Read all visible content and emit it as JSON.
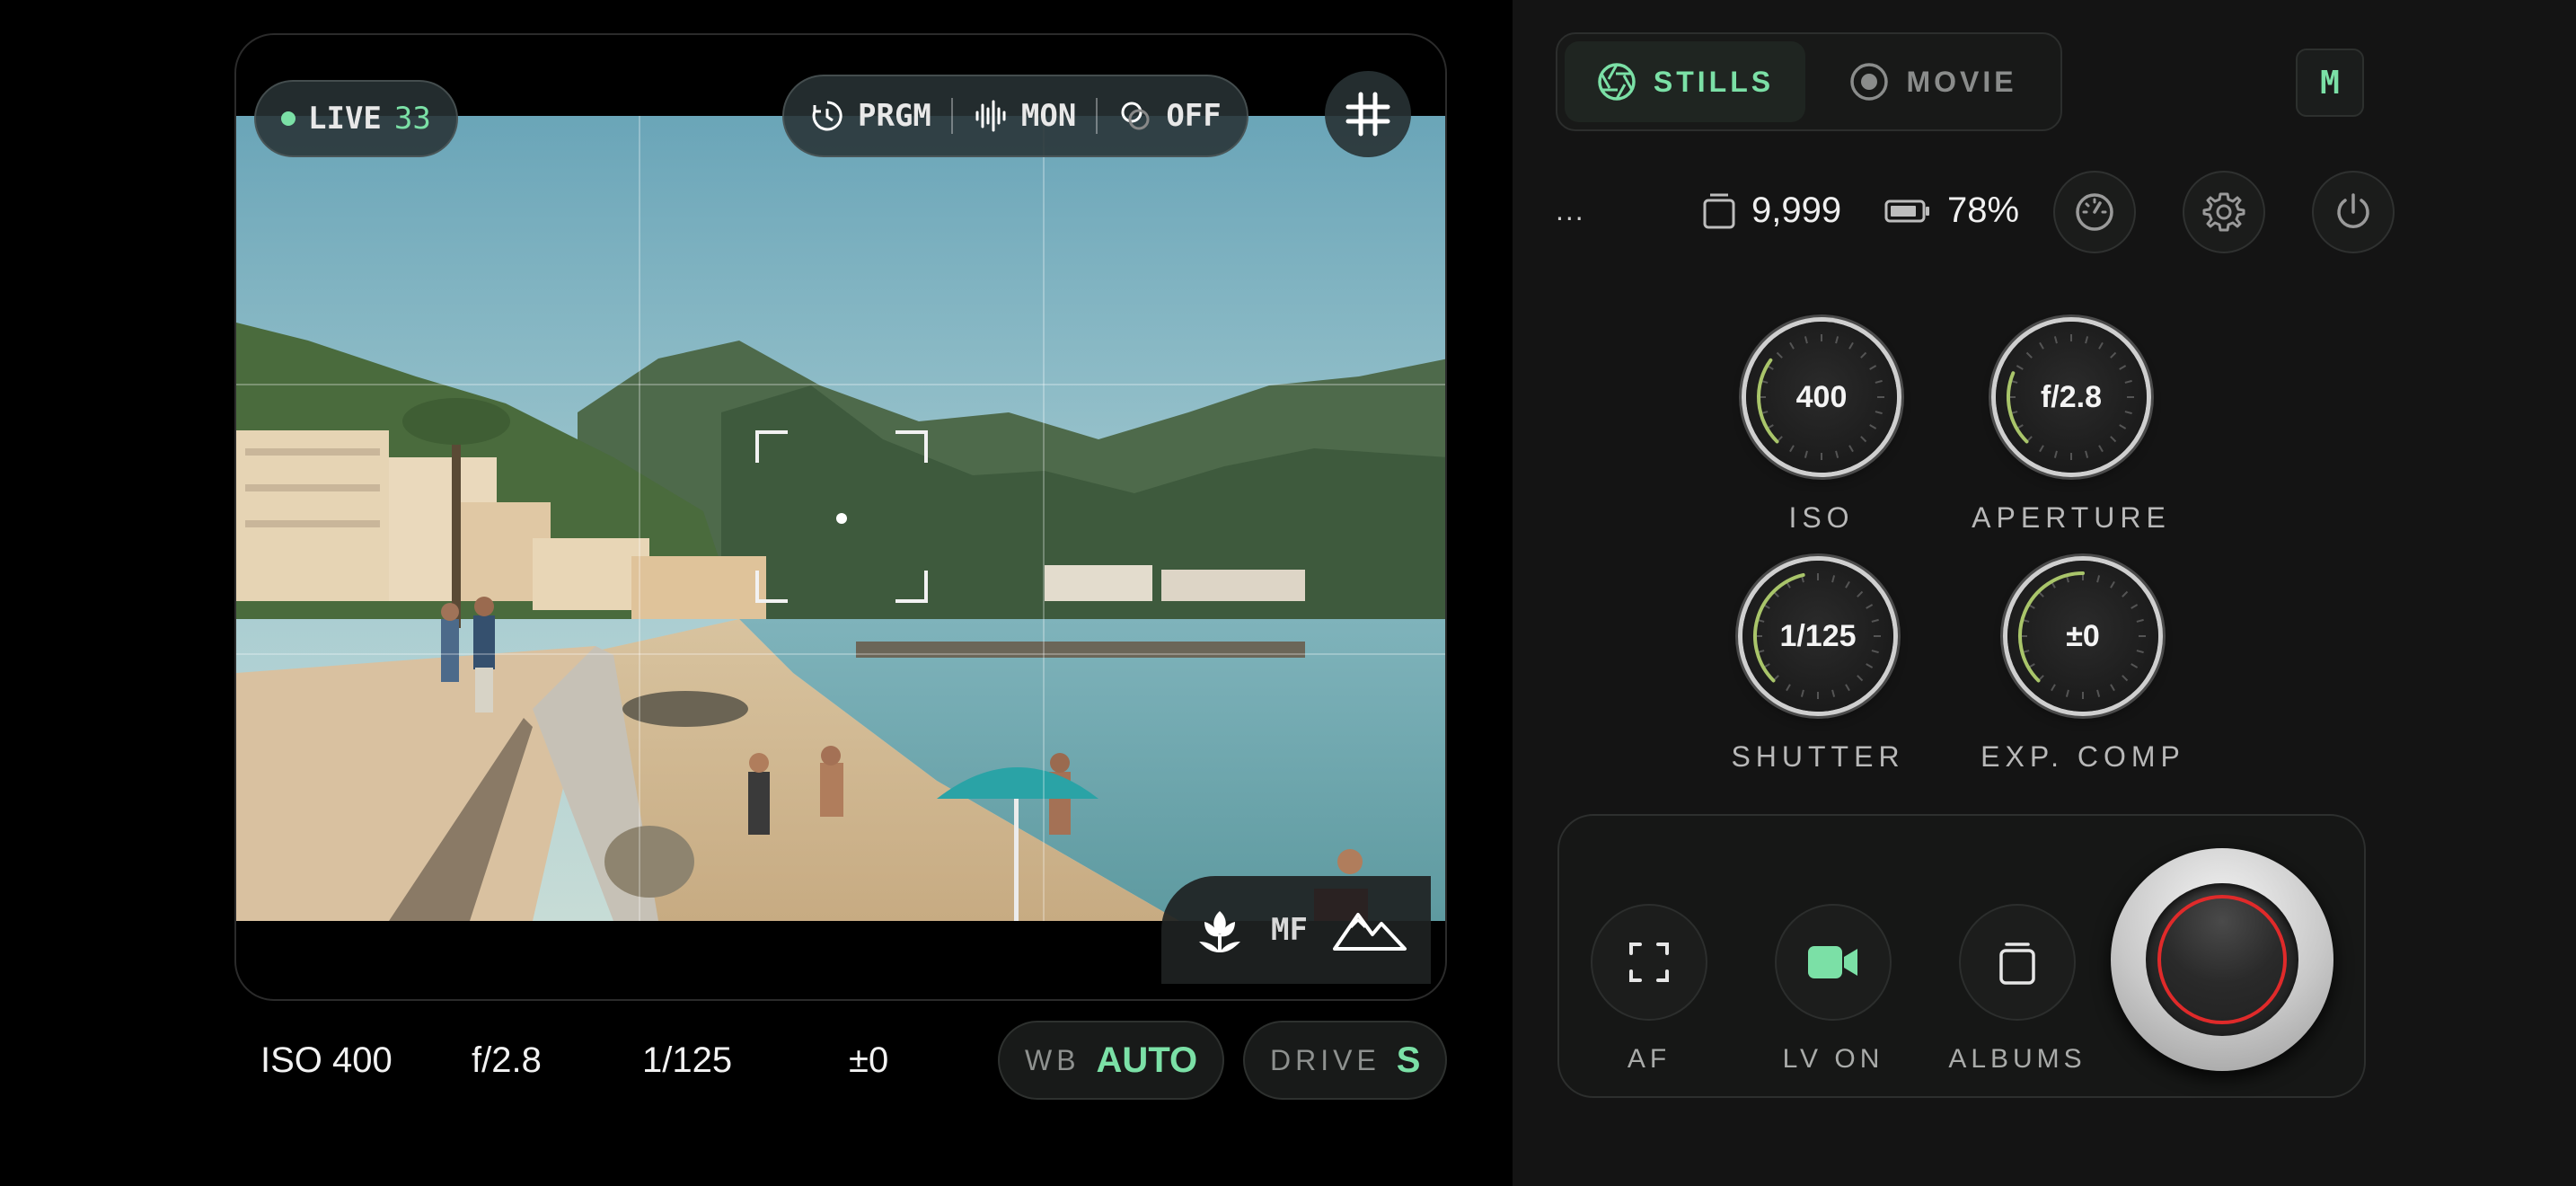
{
  "viewfinder": {
    "live_label": "LIVE",
    "live_count": "33",
    "mode_items": [
      {
        "label": "PRGM",
        "icon": "timer-icon"
      },
      {
        "label": "MON",
        "icon": "waveform-icon"
      },
      {
        "label": "OFF",
        "icon": "overlay-icon"
      }
    ],
    "grid_icon": "grid-icon",
    "focus_mode": "MF",
    "focus_near_icon": "flower-macro-icon",
    "focus_far_icon": "mountain-icon"
  },
  "readouts": {
    "iso": "ISO 400",
    "aperture": "f/2.8",
    "shutter": "1/125",
    "exposure": "±0"
  },
  "wb": {
    "label": "WB",
    "value": "AUTO"
  },
  "drive": {
    "label": "DRIVE",
    "value": "S"
  },
  "mode_tabs": [
    {
      "label": "STILLS",
      "icon": "aperture-icon",
      "active": true
    },
    {
      "label": "MOVIE",
      "icon": "record-icon",
      "active": false
    }
  ],
  "exposure_mode": "M",
  "status": {
    "more": "...",
    "shots_remaining": "9,999",
    "battery": "78%"
  },
  "dials": [
    {
      "id": "iso",
      "value": "400",
      "label": "ISO",
      "level": 0.3
    },
    {
      "id": "aperture",
      "value": "f/2.8",
      "label": "APERTURE",
      "level": 0.25
    },
    {
      "id": "shutter",
      "value": "1/125",
      "label": "SHUTTER",
      "level": 0.45
    },
    {
      "id": "exp",
      "value": "±0",
      "label": "EXP. COMP",
      "level": 0.5
    }
  ],
  "bottom": {
    "af_label": "AF",
    "lv_label": "LV ON",
    "albums_label": "ALBUMS"
  },
  "colors": {
    "accent": "#7be0a6",
    "dial_arc": "#a9c56a",
    "shutter_ring": "#e02a2a"
  }
}
